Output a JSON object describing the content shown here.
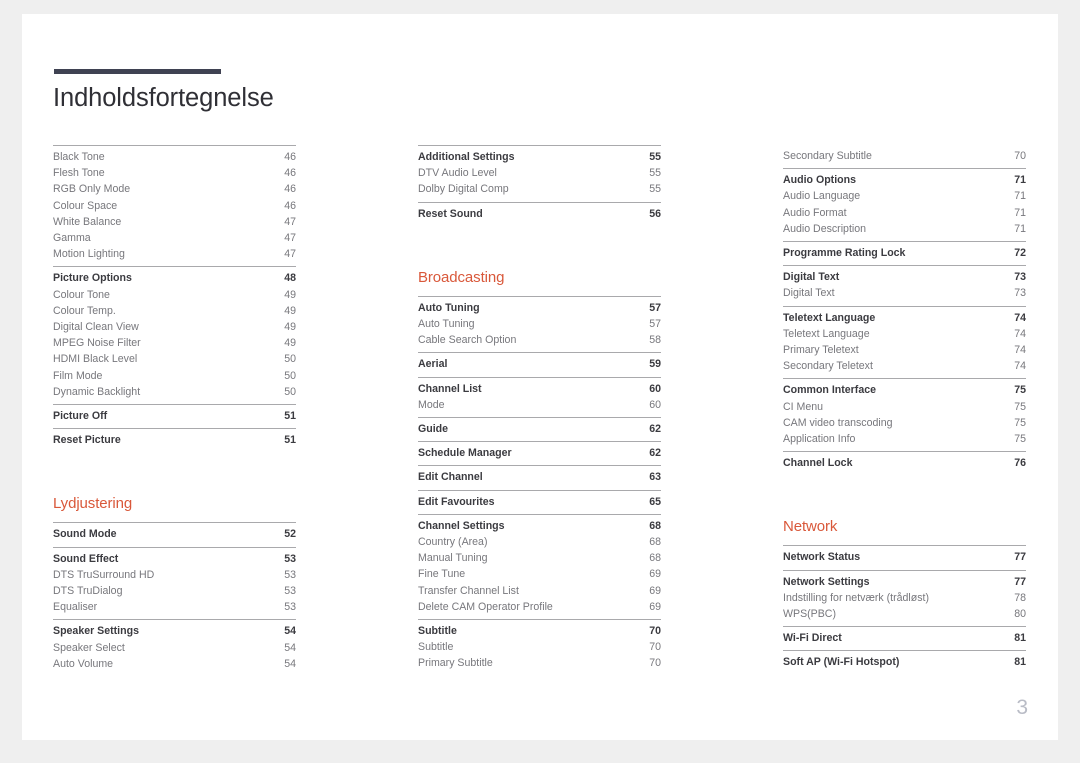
{
  "document": {
    "title": "Indholdsfortegnelse",
    "page_number": "3",
    "accent_color": "#d9583a",
    "rule_color": "#3f4252"
  },
  "columns": [
    {
      "name": "column-left",
      "blocks": [
        {
          "type": "group",
          "rule": true,
          "entries": [
            {
              "level": "sub",
              "label": "Black Tone",
              "page": "46"
            },
            {
              "level": "sub",
              "label": "Flesh Tone",
              "page": "46"
            },
            {
              "level": "sub",
              "label": "RGB Only Mode",
              "page": "46"
            },
            {
              "level": "sub",
              "label": "Colour Space",
              "page": "46"
            },
            {
              "level": "sub",
              "label": "White Balance",
              "page": "47"
            },
            {
              "level": "sub",
              "label": "Gamma",
              "page": "47"
            },
            {
              "level": "sub",
              "label": "Motion Lighting",
              "page": "47"
            }
          ]
        },
        {
          "type": "group",
          "rule": true,
          "entries": [
            {
              "level": "head",
              "label": "Picture Options",
              "page": "48"
            },
            {
              "level": "sub",
              "label": "Colour Tone",
              "page": "49"
            },
            {
              "level": "sub",
              "label": "Colour Temp.",
              "page": "49"
            },
            {
              "level": "sub",
              "label": "Digital Clean View",
              "page": "49"
            },
            {
              "level": "sub",
              "label": "MPEG Noise Filter",
              "page": "49"
            },
            {
              "level": "sub",
              "label": "HDMI Black Level",
              "page": "50"
            },
            {
              "level": "sub",
              "label": "Film Mode",
              "page": "50"
            },
            {
              "level": "sub",
              "label": "Dynamic Backlight",
              "page": "50"
            }
          ]
        },
        {
          "type": "group",
          "rule": true,
          "entries": [
            {
              "level": "head",
              "label": "Picture Off",
              "page": "51"
            }
          ]
        },
        {
          "type": "group",
          "rule": true,
          "entries": [
            {
              "level": "head",
              "label": "Reset Picture",
              "page": "51"
            }
          ]
        },
        {
          "type": "heading",
          "label": "Lydjustering"
        },
        {
          "type": "group",
          "rule": true,
          "entries": [
            {
              "level": "head",
              "label": "Sound Mode",
              "page": "52"
            }
          ]
        },
        {
          "type": "group",
          "rule": true,
          "entries": [
            {
              "level": "head",
              "label": "Sound Effect",
              "page": "53"
            },
            {
              "level": "sub",
              "label": "DTS TruSurround HD",
              "page": "53"
            },
            {
              "level": "sub",
              "label": "DTS TruDialog",
              "page": "53"
            },
            {
              "level": "sub",
              "label": "Equaliser",
              "page": "53"
            }
          ]
        },
        {
          "type": "group",
          "rule": true,
          "entries": [
            {
              "level": "head",
              "label": "Speaker Settings",
              "page": "54"
            },
            {
              "level": "sub",
              "label": "Speaker Select",
              "page": "54"
            },
            {
              "level": "sub",
              "label": "Auto Volume",
              "page": "54"
            }
          ]
        }
      ]
    },
    {
      "name": "column-middle",
      "blocks": [
        {
          "type": "group",
          "rule": true,
          "entries": [
            {
              "level": "head",
              "label": "Additional Settings",
              "page": "55"
            },
            {
              "level": "sub",
              "label": "DTV Audio Level",
              "page": "55"
            },
            {
              "level": "sub",
              "label": "Dolby Digital Comp",
              "page": "55"
            }
          ]
        },
        {
          "type": "group",
          "rule": true,
          "entries": [
            {
              "level": "head",
              "label": "Reset Sound",
              "page": "56"
            }
          ]
        },
        {
          "type": "heading",
          "label": "Broadcasting"
        },
        {
          "type": "group",
          "rule": true,
          "entries": [
            {
              "level": "head",
              "label": "Auto Tuning",
              "page": "57"
            },
            {
              "level": "sub",
              "label": "Auto Tuning",
              "page": "57"
            },
            {
              "level": "sub",
              "label": "Cable Search Option",
              "page": "58"
            }
          ]
        },
        {
          "type": "group",
          "rule": true,
          "entries": [
            {
              "level": "head",
              "label": "Aerial",
              "page": "59"
            }
          ]
        },
        {
          "type": "group",
          "rule": true,
          "entries": [
            {
              "level": "head",
              "label": "Channel List",
              "page": "60"
            },
            {
              "level": "sub",
              "label": "Mode",
              "page": "60"
            }
          ]
        },
        {
          "type": "group",
          "rule": true,
          "entries": [
            {
              "level": "head",
              "label": "Guide",
              "page": "62"
            }
          ]
        },
        {
          "type": "group",
          "rule": true,
          "entries": [
            {
              "level": "head",
              "label": "Schedule Manager",
              "page": "62"
            }
          ]
        },
        {
          "type": "group",
          "rule": true,
          "entries": [
            {
              "level": "head",
              "label": "Edit Channel",
              "page": "63"
            }
          ]
        },
        {
          "type": "group",
          "rule": true,
          "entries": [
            {
              "level": "head",
              "label": "Edit Favourites",
              "page": "65"
            }
          ]
        },
        {
          "type": "group",
          "rule": true,
          "entries": [
            {
              "level": "head",
              "label": "Channel Settings",
              "page": "68"
            },
            {
              "level": "sub",
              "label": "Country (Area)",
              "page": "68"
            },
            {
              "level": "sub",
              "label": "Manual Tuning",
              "page": "68"
            },
            {
              "level": "sub",
              "label": "Fine Tune",
              "page": "69"
            },
            {
              "level": "sub",
              "label": "Transfer Channel List",
              "page": "69"
            },
            {
              "level": "sub",
              "label": "Delete CAM Operator Profile",
              "page": "69"
            }
          ]
        },
        {
          "type": "group",
          "rule": true,
          "entries": [
            {
              "level": "head",
              "label": "Subtitle",
              "page": "70"
            },
            {
              "level": "sub",
              "label": "Subtitle",
              "page": "70"
            },
            {
              "level": "sub",
              "label": "Primary Subtitle",
              "page": "70"
            }
          ]
        }
      ]
    },
    {
      "name": "column-right",
      "blocks": [
        {
          "type": "group",
          "rule": false,
          "entries": [
            {
              "level": "sub",
              "label": "Secondary Subtitle",
              "page": "70"
            }
          ]
        },
        {
          "type": "group",
          "rule": true,
          "entries": [
            {
              "level": "head",
              "label": "Audio Options",
              "page": "71"
            },
            {
              "level": "sub",
              "label": "Audio Language",
              "page": "71"
            },
            {
              "level": "sub",
              "label": "Audio Format",
              "page": "71"
            },
            {
              "level": "sub",
              "label": "Audio Description",
              "page": "71"
            }
          ]
        },
        {
          "type": "group",
          "rule": true,
          "entries": [
            {
              "level": "head",
              "label": "Programme Rating Lock",
              "page": "72"
            }
          ]
        },
        {
          "type": "group",
          "rule": true,
          "entries": [
            {
              "level": "head",
              "label": "Digital Text",
              "page": "73"
            },
            {
              "level": "sub",
              "label": "Digital Text",
              "page": "73"
            }
          ]
        },
        {
          "type": "group",
          "rule": true,
          "entries": [
            {
              "level": "head",
              "label": "Teletext Language",
              "page": "74"
            },
            {
              "level": "sub",
              "label": "Teletext Language",
              "page": "74"
            },
            {
              "level": "sub",
              "label": "Primary Teletext",
              "page": "74"
            },
            {
              "level": "sub",
              "label": "Secondary Teletext",
              "page": "74"
            }
          ]
        },
        {
          "type": "group",
          "rule": true,
          "entries": [
            {
              "level": "head",
              "label": "Common Interface",
              "page": "75"
            },
            {
              "level": "sub",
              "label": "CI Menu",
              "page": "75"
            },
            {
              "level": "sub",
              "label": "CAM video transcoding",
              "page": "75"
            },
            {
              "level": "sub",
              "label": "Application Info",
              "page": "75"
            }
          ]
        },
        {
          "type": "group",
          "rule": true,
          "entries": [
            {
              "level": "head",
              "label": "Channel Lock",
              "page": "76"
            }
          ]
        },
        {
          "type": "heading",
          "label": "Network"
        },
        {
          "type": "group",
          "rule": true,
          "entries": [
            {
              "level": "head",
              "label": "Network Status",
              "page": "77"
            }
          ]
        },
        {
          "type": "group",
          "rule": true,
          "entries": [
            {
              "level": "head",
              "label": "Network Settings",
              "page": "77"
            },
            {
              "level": "sub",
              "label": "Indstilling for netværk (trådløst)",
              "page": "78"
            },
            {
              "level": "sub",
              "label": "WPS(PBC)",
              "page": "80"
            }
          ]
        },
        {
          "type": "group",
          "rule": true,
          "entries": [
            {
              "level": "head",
              "label": "Wi-Fi Direct",
              "page": "81"
            }
          ]
        },
        {
          "type": "group",
          "rule": true,
          "entries": [
            {
              "level": "head",
              "label": "Soft AP (Wi-Fi Hotspot)",
              "page": "81"
            }
          ]
        }
      ]
    }
  ]
}
